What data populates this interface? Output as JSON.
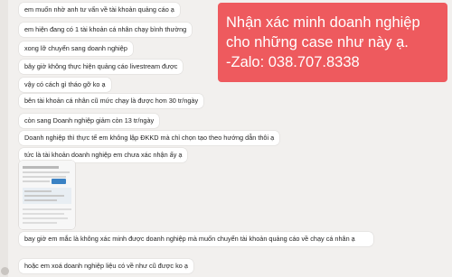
{
  "messages": [
    "em muốn nhờ anh tư vấn về tài khoản quảng cáo ạ",
    "em hiện đang có 1 tài khoản cá nhân chạy bình thường",
    "xong lỡ chuyển sang doanh nghiệp",
    "bây giờ không thực hiện quảng cáo livestream được",
    "vậy có cách gì tháo gỡ ko ạ",
    "bên tài khoản cá nhân cũ mức chạy là được hơn 30 tr/ngày",
    "còn sang Doanh nghiệp giảm còn 13 tr/ngày",
    "Doanh nghiệp thì thực tế em không lập ĐKKD mà chỉ chọn tạo theo hướng dẫn thôi ạ",
    "tức là tài khoản doanh nghiệp em chưa xác nhận ấy ạ",
    "bay giờ em mắc là không xác minh được doanh nghiệp mà muốn chuyển tài khoản quảng cáo về chạy cá nhân ạ",
    "hoặc em xoá doanh nghiệp liệu có về như cũ được ko ạ"
  ],
  "promo": {
    "line1": "Nhận xác minh doanh nghiệp",
    "line2": "cho những case như này ạ.",
    "line3": "-Zalo: 038.707.8338"
  },
  "colors": {
    "promo_bg": "#ee5a5e",
    "bubble_bg": "#ffffff",
    "chat_bg": "#f2f0ee"
  }
}
